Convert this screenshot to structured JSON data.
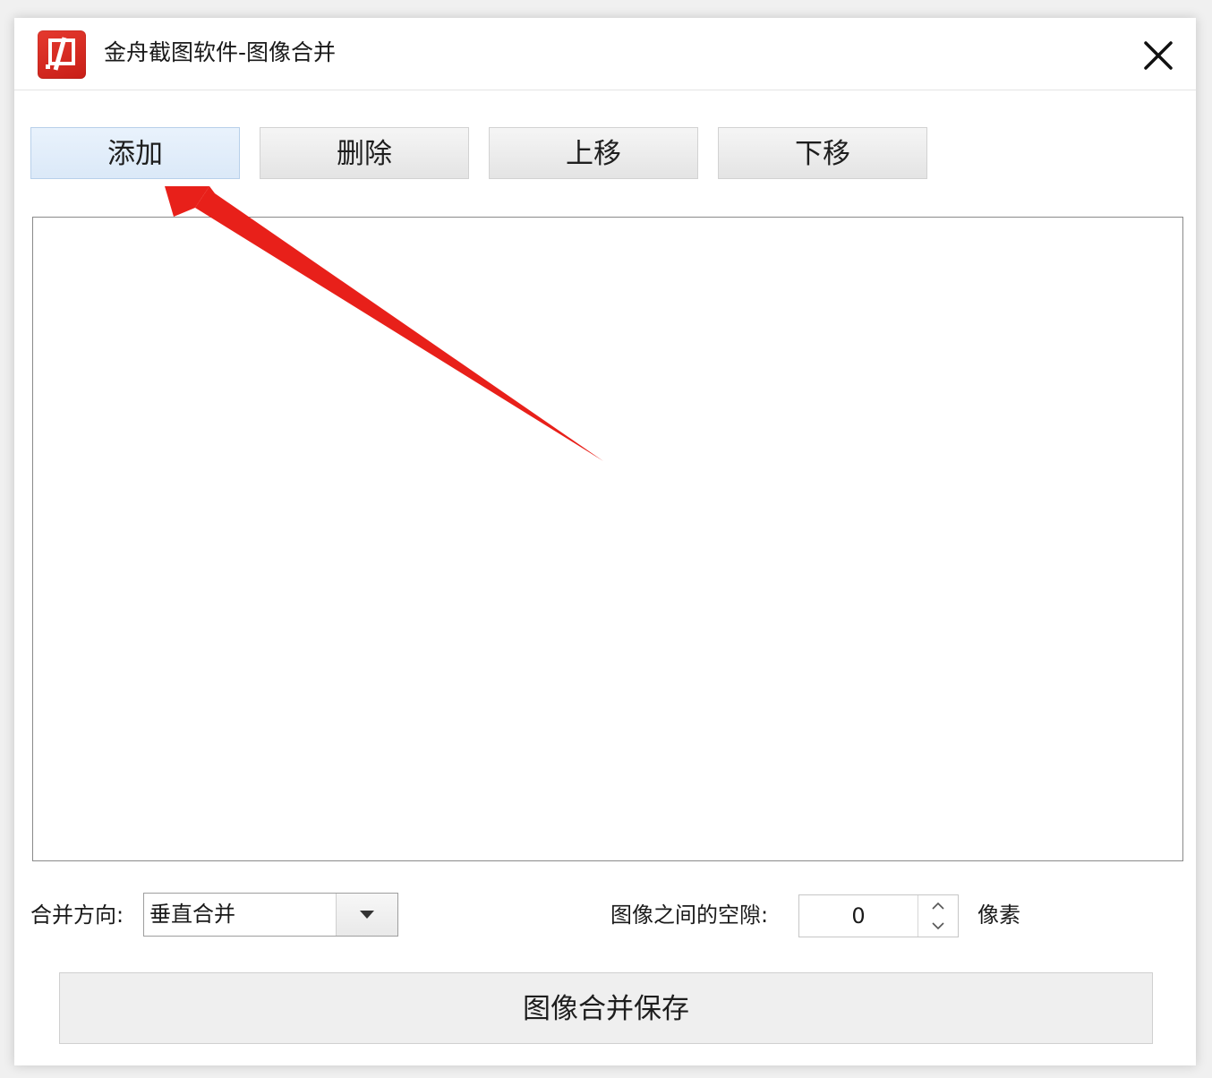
{
  "window": {
    "title": "金舟截图软件-图像合并",
    "logo_icon": "app-logo-icon",
    "close_icon": "close-icon"
  },
  "toolbar": {
    "add_label": "添加",
    "delete_label": "删除",
    "move_up_label": "上移",
    "move_down_label": "下移"
  },
  "image_list": {
    "items": []
  },
  "merge_direction": {
    "label": "合并方向:",
    "value": "垂直合并",
    "arrow_icon": "chevron-down-icon"
  },
  "spacing": {
    "label": "图像之间的空隙:",
    "value": "0",
    "unit": "像素"
  },
  "save_button": {
    "label": "图像合并保存"
  },
  "annotation": {
    "arrow_color": "#e8201a",
    "target": "add-button"
  },
  "colors": {
    "brand_red": "#d4251c",
    "active_button_bg": "#e3eefa"
  }
}
